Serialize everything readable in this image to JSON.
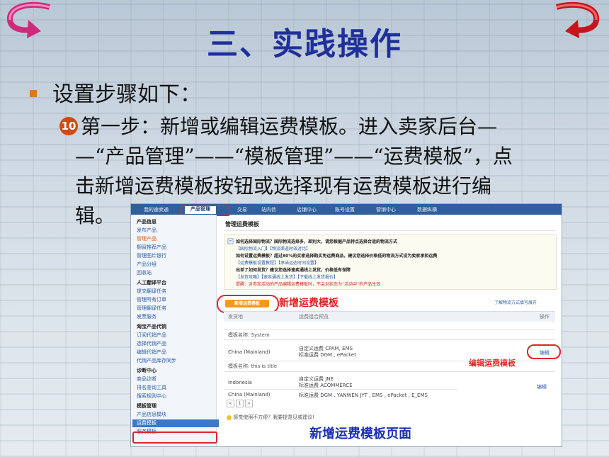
{
  "slide": {
    "title": "三、实践操作",
    "bullet": "设置步骤如下：",
    "step_marker": "10",
    "step_lines": [
      "第一步：新增或编辑运费模板。进入卖家后台—",
      "—“产品管理”——“模板管理”——“运费模板”，点",
      "击新增运费模板按钮或选择现有运费模板进行编",
      "辑。"
    ],
    "caption": "新增运费模板页面"
  },
  "screenshot": {
    "nav": [
      "我的速卖通",
      "产品管理",
      "交易",
      "站内信",
      "店铺中心",
      "账号设置",
      "营销中心",
      "数据纵横"
    ],
    "nav_active": "产品管理",
    "sidebar": [
      {
        "label": "产品信息",
        "kind": "h"
      },
      {
        "label": "发布产品",
        "kind": "link"
      },
      {
        "label": "管理产品",
        "kind": "cur"
      },
      {
        "label": "橱窗推荐产品",
        "kind": "link"
      },
      {
        "label": "管理图片银行",
        "kind": "link"
      },
      {
        "label": "产品分组",
        "kind": "link"
      },
      {
        "label": "回收站",
        "kind": "link"
      },
      {
        "label": "人工翻译平台",
        "kind": "h"
      },
      {
        "label": "提交翻译任务",
        "kind": "link"
      },
      {
        "label": "管理所有订单",
        "kind": "link"
      },
      {
        "label": "管理翻译任务",
        "kind": "link"
      },
      {
        "label": "发票服务",
        "kind": "link"
      },
      {
        "label": "淘宝产品代销",
        "kind": "h"
      },
      {
        "label": "订阅代销产品",
        "kind": "link"
      },
      {
        "label": "选择代销产品",
        "kind": "link"
      },
      {
        "label": "编辑代销产品",
        "kind": "link"
      },
      {
        "label": "代销产品库存同步",
        "kind": "link"
      },
      {
        "label": "诊断中心",
        "kind": "h"
      },
      {
        "label": "商品诊断",
        "kind": "link"
      },
      {
        "label": "排名查询工具",
        "kind": "link"
      },
      {
        "label": "搜索规则中心",
        "kind": "link"
      },
      {
        "label": "模板管理",
        "kind": "h"
      },
      {
        "label": "产品信息模块",
        "kind": "link"
      },
      {
        "label": "运费模板",
        "kind": "sel"
      },
      {
        "label": "服务模板",
        "kind": "link"
      }
    ],
    "page_title": "管理运费模板",
    "notice": [
      {
        "text": "如何选择国际物流？国际物流选择多，差别大，请您根据产品特点选择合适的物流方式",
        "kind": "nb"
      },
      {
        "text": "【国际物流入门】【物流渠道时效对比】",
        "kind": "nl"
      },
      {
        "text": "如何设置运费模板？超过80%的买家选择购买免运费商品，建议您选择价格低的物流方式设为卖家承担运费",
        "kind": "nb"
      },
      {
        "text": "【运费模板设置教程】【承诺运达时间设置】",
        "kind": "nl"
      },
      {
        "text": "出单了如何发货？建议您选择速卖通线上发货，价格低有保障",
        "kind": "nb"
      },
      {
        "text": "【发货攻略】【速卖通线上发货】【下载线上发货报价】",
        "kind": "nl"
      },
      {
        "text": "提醒：对参加活动的产品编辑运费模板时，不会对状态为“活动中”的产品生效",
        "kind": "nr"
      }
    ],
    "add_button": "新增运费模板",
    "annotation_add": "新增运费模板",
    "annotation_edit": "编辑运费模板",
    "help_link": "了解物流方式填写展开",
    "table_headers": {
      "dest": "发货地",
      "combo": "运费组合预览",
      "op": "操作"
    },
    "template1": {
      "name_label": "模板名称: System",
      "rows": [
        {
          "dest": "China (Mainland)",
          "lines": [
            "自定义运费 CPAM, EMS",
            "标准运费 DGM , ePacket"
          ]
        }
      ],
      "edit": "编辑"
    },
    "template2": {
      "name_label": "模板名称: this is title",
      "rows": [
        {
          "dest": "Indonesia",
          "lines": [
            "自定义运费 JNE",
            "标准运费 ACOMMERCE"
          ]
        },
        {
          "dest": "China (Mainland)",
          "lines": [
            "标准运费 DGM , YANWEN JYT , EMS , ePacket , E_EMS"
          ]
        }
      ],
      "edit": "编辑"
    },
    "pager": [
      "<",
      "1",
      ">"
    ],
    "feedback": "感觉使用不方便？我要提意见或建议!"
  },
  "colors": {
    "title": "#1f2f9c",
    "annotation": "#e0201e",
    "caption": "#1a2fb0",
    "nav": "#2f5f9c",
    "add_button": "#f39a1a"
  }
}
